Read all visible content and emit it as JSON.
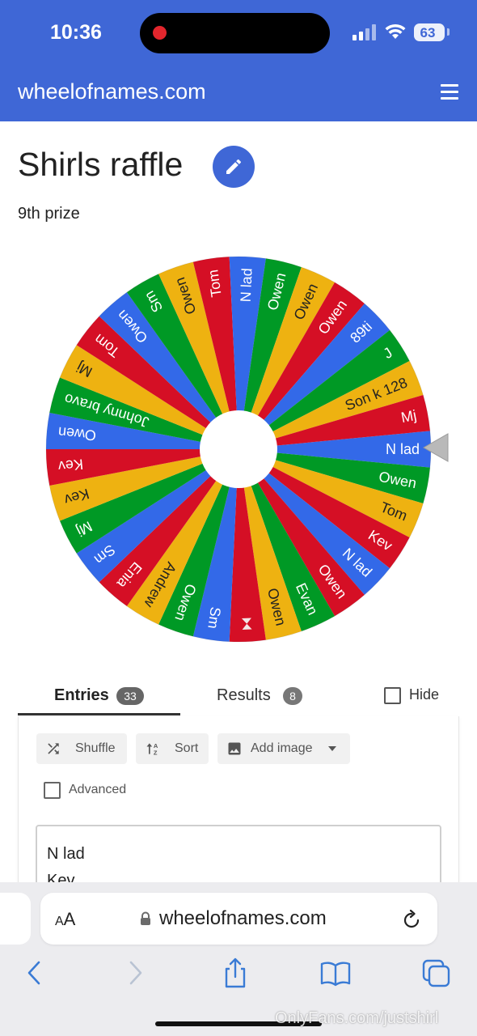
{
  "status_bar": {
    "time": "10:36",
    "battery": "63"
  },
  "header": {
    "site_title": "wheelofnames.com",
    "menu_icon": "hamburger-menu-icon"
  },
  "page": {
    "title": "Shirls raffle",
    "subtitle": "9th prize",
    "edit_icon": "pencil-icon"
  },
  "wheel": {
    "colors": [
      "#3369e8",
      "#009925",
      "#eeb211",
      "#d50f25"
    ],
    "slices": [
      "N lad",
      "Owen",
      "Tom",
      "Kev",
      "N lad",
      "Owen",
      "Evan",
      "Owen",
      "",
      "Sm",
      "Owen",
      "Andrew",
      "Enia",
      "Sm",
      "Mj",
      "Kev",
      "Kev",
      "Owen",
      "Johnny bravo",
      "Mj",
      "Tom",
      "Owen",
      "Sm",
      "Owen",
      "Tom",
      "N lad",
      "Owen",
      "Owen",
      "Owen",
      "89ti",
      "J",
      "Son k 128",
      "Mj"
    ],
    "slice_colors": [
      "#3369e8",
      "#009925",
      "#eeb211",
      "#d50f25",
      "#3369e8",
      "#d50f25",
      "#009925",
      "#eeb211",
      "#d50f25",
      "#3369e8",
      "#009925",
      "#eeb211",
      "#d50f25",
      "#3369e8",
      "#009925",
      "#eeb211",
      "#d50f25",
      "#3369e8",
      "#009925",
      "#eeb211",
      "#d50f25",
      "#3369e8",
      "#009925",
      "#eeb211",
      "#d50f25",
      "#3369e8",
      "#009925",
      "#eeb211",
      "#d50f25",
      "#3369e8",
      "#009925",
      "#eeb211",
      "#d50f25"
    ],
    "pointer_icon": "triangle-pointer-icon"
  },
  "tabs": {
    "entries": {
      "label": "Entries",
      "count": "33"
    },
    "results": {
      "label": "Results",
      "count": "8"
    },
    "hide_label": "Hide"
  },
  "toolbar": {
    "shuffle_label": "Shuffle",
    "sort_label": "Sort",
    "add_image_label": "Add image",
    "advanced_label": "Advanced"
  },
  "entries": {
    "lines": [
      "N lad",
      "Kev"
    ]
  },
  "browser": {
    "aa": "A",
    "aa_large": "A",
    "url": "wheelofnames.com"
  },
  "watermark": "OnlyFans.com/justshirl"
}
